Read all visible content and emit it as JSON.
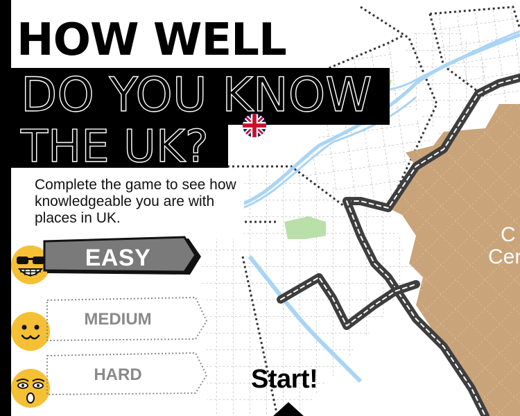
{
  "title": {
    "line1": "HOW WELL",
    "line2": "DO YOU KNOW",
    "line3": "THE UK?"
  },
  "description": "Complete the game to see how knowledgeable you are with places in UK.",
  "flag_icon": "uk-flag-icon",
  "levels": [
    {
      "label": "EASY",
      "selected": true,
      "emoji_icon": "cool-sunglasses-emoji-icon"
    },
    {
      "label": "MEDIUM",
      "selected": false,
      "emoji_icon": "smiling-face-emoji-icon"
    },
    {
      "label": "HARD",
      "selected": false,
      "emoji_icon": "scared-face-emoji-icon"
    }
  ],
  "start_label": "Start!",
  "map": {
    "city_center_label_line1": "C",
    "city_center_label_line2": "Cen",
    "colors": {
      "city_center": "#c9a47a",
      "river": "#a9d4f5",
      "park": "#b8e0a8",
      "road": "#3e3e3e",
      "grid": "#9a9a9a"
    }
  },
  "colors": {
    "emoji_yellow": "#f6c034",
    "easy_button": "#7a7a7a"
  }
}
